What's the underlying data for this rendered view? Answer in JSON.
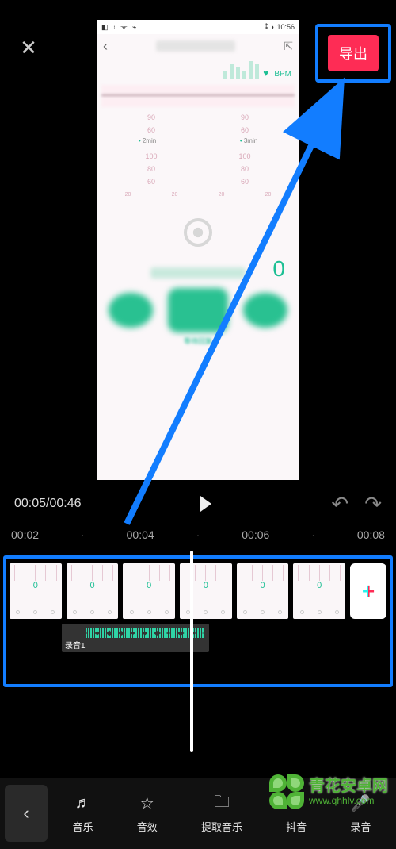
{
  "topbar": {
    "close_icon": "✕",
    "export_label": "导出"
  },
  "preview": {
    "status_time": "10:56",
    "status_icons": "◧ ⁝ ⫘ ⌁",
    "status_right": "⁑ ◗",
    "back": "‹",
    "share": "⇱",
    "bpm": "BPM",
    "heart": "♥",
    "graph_label": "",
    "scales_a": [
      "90",
      "90"
    ],
    "scales_b": [
      "60",
      "60"
    ],
    "time_marks": [
      "2min",
      "3min"
    ],
    "scales_c": [
      "100",
      "100"
    ],
    "scales_d": [
      "80",
      "80"
    ],
    "scales_e": [
      "60",
      "60"
    ],
    "big_zero": "0",
    "miniticks": [
      "20",
      "20",
      "20",
      "20"
    ],
    "blob_caption": "等待回复"
  },
  "transport": {
    "current": "00:05",
    "sep": "/",
    "total": "00:46",
    "undo": "↶",
    "redo": "↷"
  },
  "ruler": {
    "t1": "00:02",
    "t2": "00:04",
    "t3": "00:06",
    "t4": "00:08",
    "dot": "·"
  },
  "tracks": {
    "clip_zero": "0",
    "add": "+",
    "audio_label": "录音1"
  },
  "toolbar": {
    "back": "‹",
    "items": [
      {
        "icon": "music-note-icon",
        "glyph": "♬",
        "label": "音乐"
      },
      {
        "icon": "star-icon",
        "glyph": "☆",
        "label": "音效"
      },
      {
        "icon": "folder-icon",
        "glyph": "🗀",
        "label": "提取音乐"
      },
      {
        "icon": "tiktok-icon",
        "glyph": "♪",
        "label": "抖音"
      },
      {
        "icon": "mic-icon",
        "glyph": "🎤",
        "label": "录音"
      }
    ]
  },
  "watermark": {
    "title": "青花安卓网",
    "sub": "www.qhhlv.com"
  }
}
